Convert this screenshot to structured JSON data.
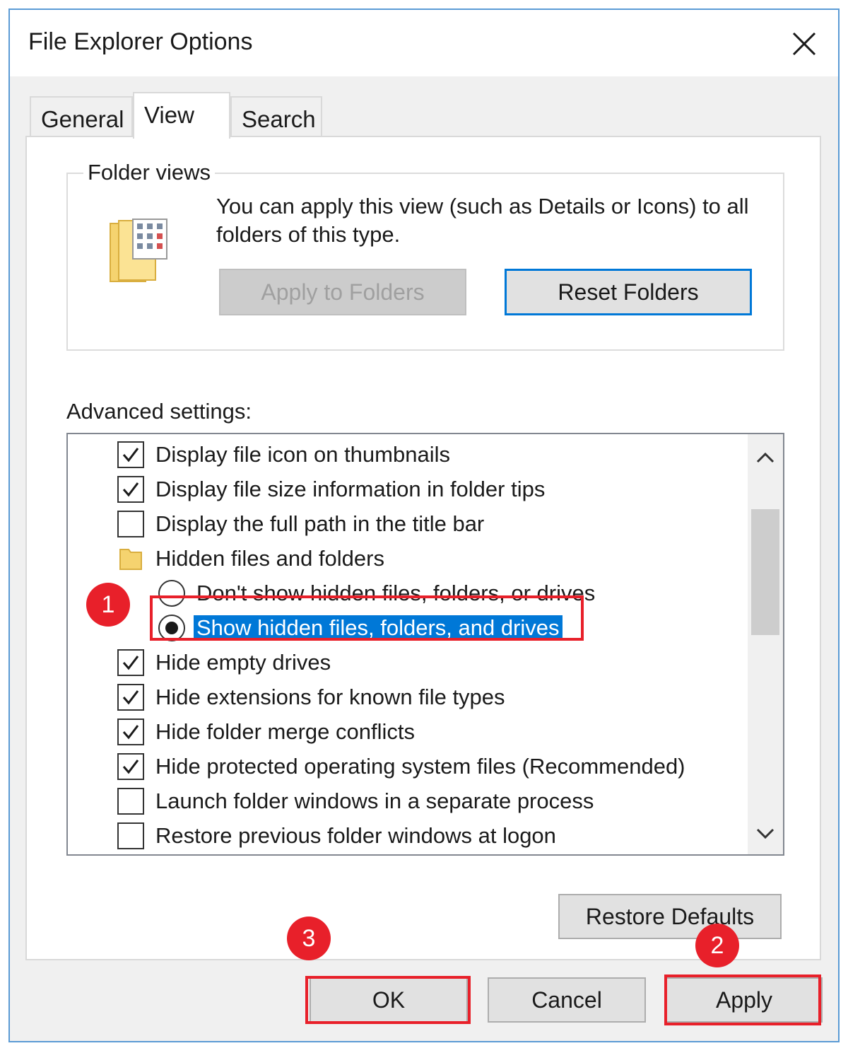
{
  "window": {
    "title": "File Explorer Options",
    "border_color": "#5b9bd5"
  },
  "tabs": [
    {
      "label": "General",
      "active": false
    },
    {
      "label": "View",
      "active": true
    },
    {
      "label": "Search",
      "active": false
    }
  ],
  "folder_views": {
    "legend": "Folder views",
    "description": "You can apply this view (such as Details or Icons) to all folders of this type.",
    "apply_button": "Apply to Folders",
    "reset_button": "Reset Folders"
  },
  "advanced": {
    "label": "Advanced settings:",
    "items": [
      {
        "type": "checkbox",
        "checked": true,
        "label": "Display file icon on thumbnails"
      },
      {
        "type": "checkbox",
        "checked": true,
        "label": "Display file size information in folder tips"
      },
      {
        "type": "checkbox",
        "checked": false,
        "label": "Display the full path in the title bar"
      },
      {
        "type": "folder",
        "label": "Hidden files and folders"
      },
      {
        "type": "radio",
        "checked": false,
        "label": "Don't show hidden files, folders, or drives"
      },
      {
        "type": "radio",
        "checked": true,
        "selected": true,
        "label": "Show hidden files, folders, and drives"
      },
      {
        "type": "checkbox",
        "checked": true,
        "label": "Hide empty drives"
      },
      {
        "type": "checkbox",
        "checked": true,
        "label": "Hide extensions for known file types"
      },
      {
        "type": "checkbox",
        "checked": true,
        "label": "Hide folder merge conflicts"
      },
      {
        "type": "checkbox",
        "checked": true,
        "label": "Hide protected operating system files (Recommended)"
      },
      {
        "type": "checkbox",
        "checked": false,
        "label": "Launch folder windows in a separate process"
      },
      {
        "type": "checkbox",
        "checked": false,
        "label": "Restore previous folder windows at logon"
      }
    ],
    "restore_defaults": "Restore Defaults"
  },
  "footer": {
    "ok": "OK",
    "cancel": "Cancel",
    "apply": "Apply"
  },
  "annotations": {
    "color": "#e8202a",
    "step1": "1",
    "step2": "2",
    "step3": "3"
  },
  "colors": {
    "selection": "#0078d7",
    "focus_border": "#0078d7"
  }
}
